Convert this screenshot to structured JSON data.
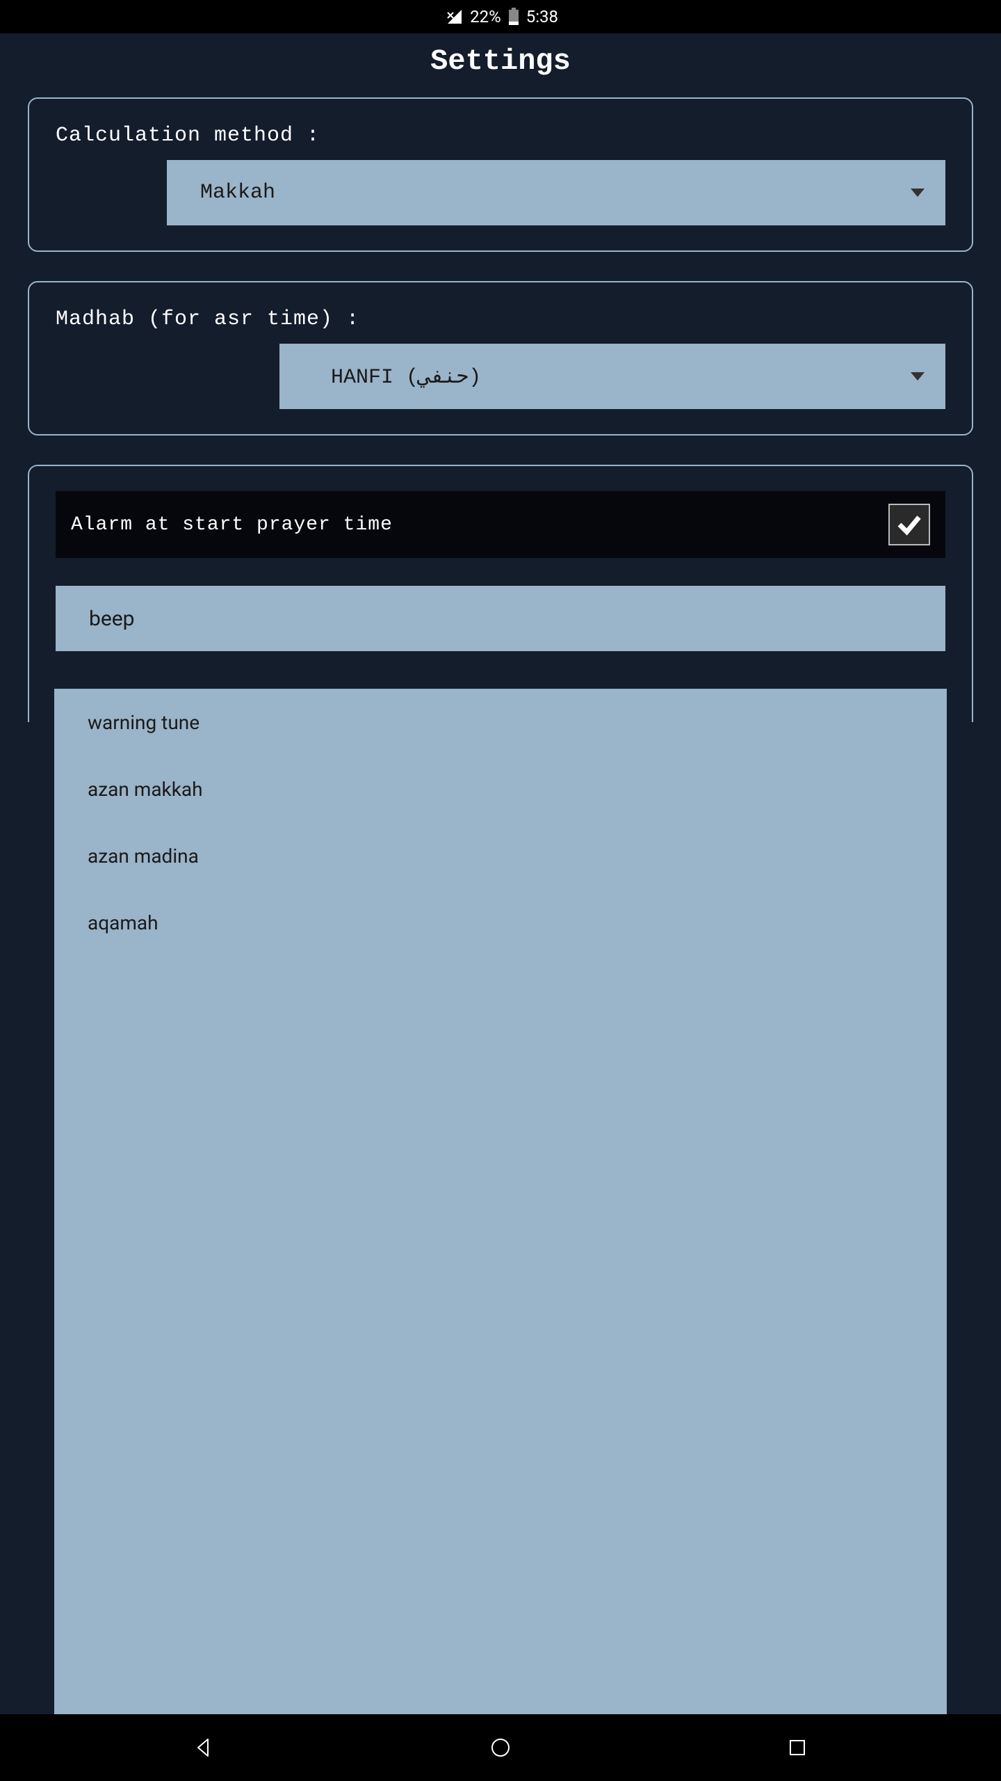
{
  "status": {
    "battery_percent": "22%",
    "time": "5:38"
  },
  "title": "Settings",
  "calc_method": {
    "label": "Calculation method :",
    "value": "Makkah"
  },
  "madhab": {
    "label": "Madhab (for asr time) :",
    "value": "HANFI (حنفي)"
  },
  "alarm": {
    "label": "Alarm at start prayer time",
    "checked": true,
    "sound_value": "beep",
    "options": [
      "warning tune",
      "azan makkah",
      "azan madina",
      "aqamah"
    ]
  }
}
